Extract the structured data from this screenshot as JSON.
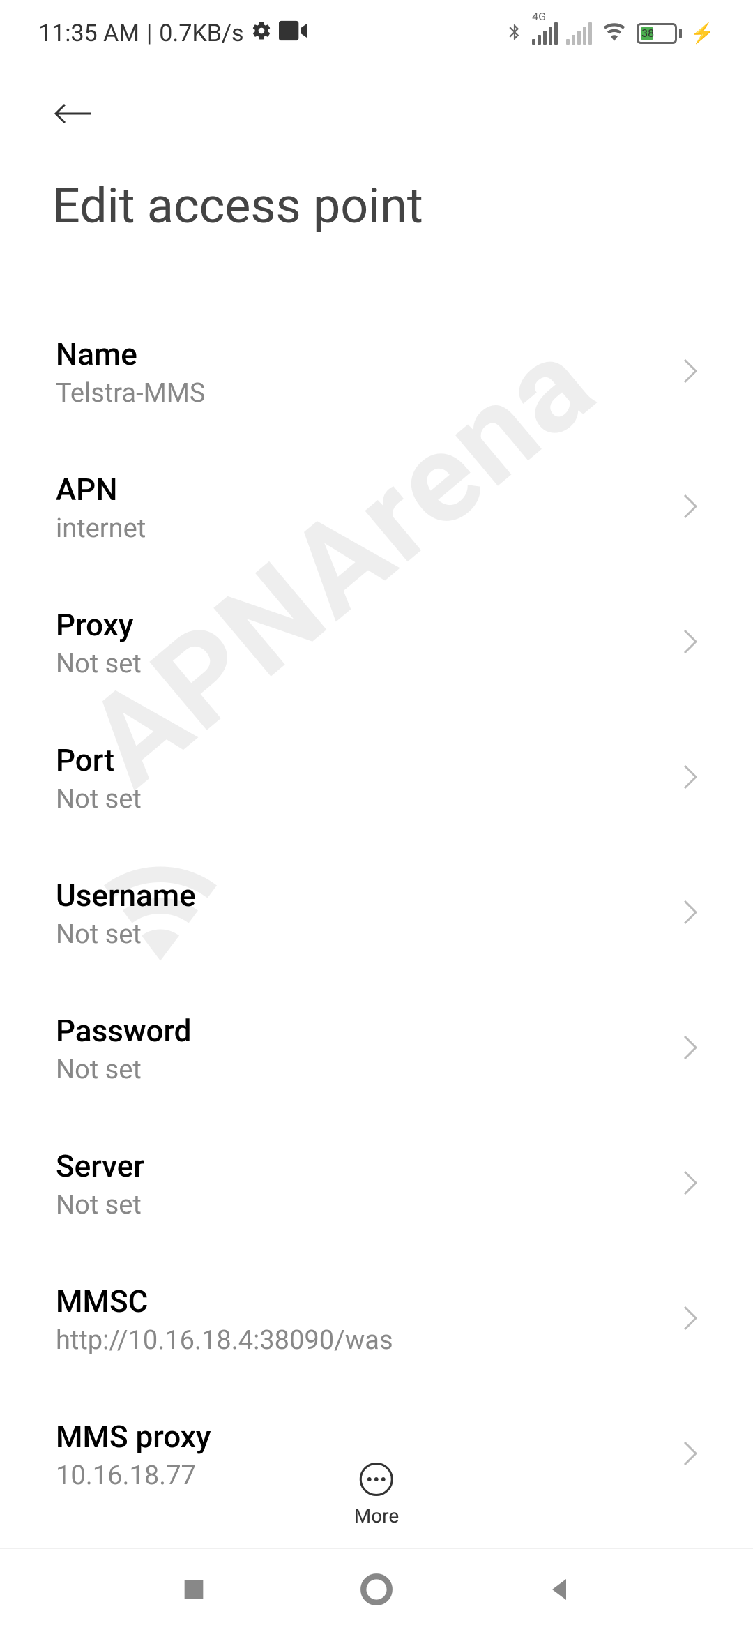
{
  "statusbar": {
    "time": "11:35 AM",
    "separator": "|",
    "speed": "0.7KB/s",
    "network_label": "4G",
    "battery_percent": "38"
  },
  "header": {
    "title": "Edit access point"
  },
  "settings": [
    {
      "label": "Name",
      "value": "Telstra-MMS"
    },
    {
      "label": "APN",
      "value": "internet"
    },
    {
      "label": "Proxy",
      "value": "Not set"
    },
    {
      "label": "Port",
      "value": "Not set"
    },
    {
      "label": "Username",
      "value": "Not set"
    },
    {
      "label": "Password",
      "value": "Not set"
    },
    {
      "label": "Server",
      "value": "Not set"
    },
    {
      "label": "MMSC",
      "value": "http://10.16.18.4:38090/was"
    },
    {
      "label": "MMS proxy",
      "value": "10.16.18.77"
    }
  ],
  "more": {
    "label": "More"
  },
  "watermark": "APNArena"
}
